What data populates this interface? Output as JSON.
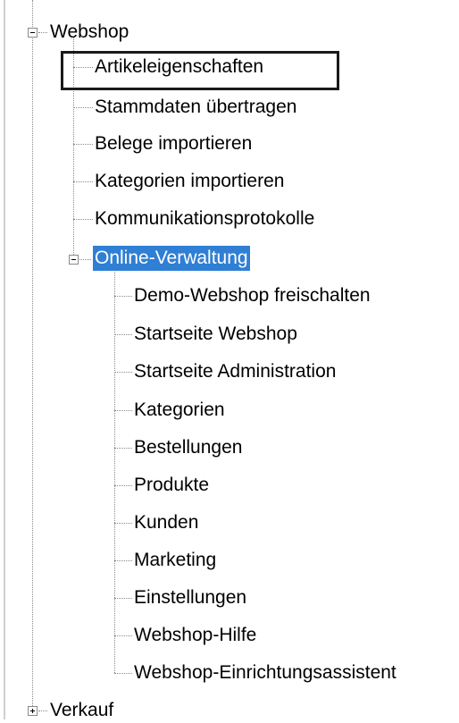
{
  "tree": {
    "webshop": {
      "label": "Webshop",
      "children": [
        "Artikeleigenschaften",
        "Stammdaten übertragen",
        "Belege importieren",
        "Kategorien importieren",
        "Kommunikationsprotokolle"
      ],
      "online": {
        "label": "Online-Verwaltung",
        "children": [
          "Demo-Webshop freischalten",
          "Startseite Webshop",
          "Startseite Administration",
          "Kategorien",
          "Bestellungen",
          "Produkte",
          "Kunden",
          "Marketing",
          "Einstellungen",
          "Webshop-Hilfe",
          "Webshop-Einrichtungsassistent"
        ]
      }
    },
    "verkauf": {
      "label": "Verkauf"
    }
  },
  "selection": {
    "highlighted": "Online-Verwaltung",
    "focused": "Artikeleigenschaften",
    "highlight_color": "#2f7fd4"
  }
}
